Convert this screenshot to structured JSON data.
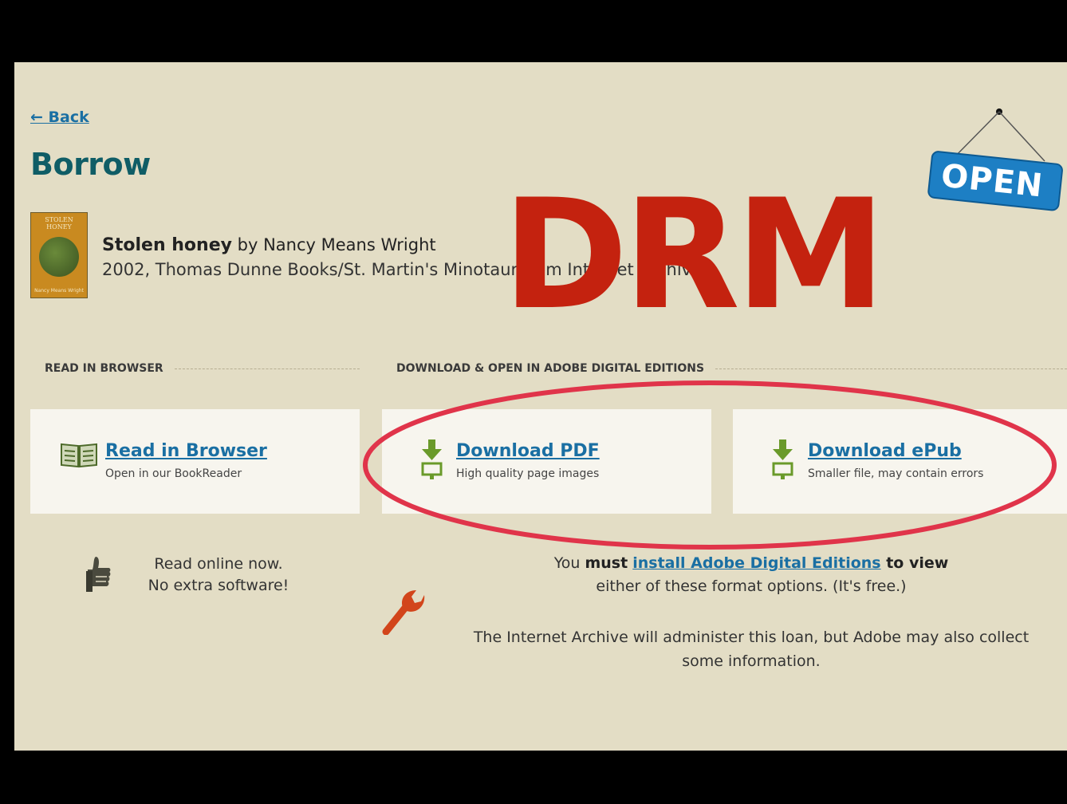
{
  "nav": {
    "back_label": "← Back"
  },
  "page": {
    "title": "Borrow"
  },
  "book": {
    "cover_title": "STOLEN HONEY",
    "cover_author": "Nancy Means Wright",
    "title": "Stolen honey",
    "by": " by Nancy Means Wright",
    "publication": "2002, Thomas Dunne Books/St. Martin's Minotaur from Internet Archive"
  },
  "sections": {
    "read_in_browser": "READ IN BROWSER",
    "download_open": "DOWNLOAD & OPEN IN ADOBE DIGITAL EDITIONS"
  },
  "cards": {
    "read": {
      "label": "Read in Browser",
      "sub": "Open in our BookReader"
    },
    "pdf": {
      "label": "Download PDF",
      "sub": "High quality page images"
    },
    "epub": {
      "label": "Download ePub",
      "sub": "Smaller file, may contain errors"
    }
  },
  "notes": {
    "read_line1": "Read online now.",
    "read_line2": "No extra software!",
    "adobe_pre": "You ",
    "adobe_must": "must",
    "adobe_space": " ",
    "adobe_link": "install Adobe Digital Editions",
    "adobe_post_bold": " to view",
    "adobe_line2": "either of these format options. (It's free.)",
    "loan": "The Internet Archive will administer this loan, but Adobe may also collect some information."
  },
  "overlay": {
    "open_sign": "OPEN",
    "drm": "DRM"
  },
  "colors": {
    "background": "#e3ddc5",
    "link": "#1a6fa3",
    "title": "#0f5d66",
    "drm_red": "#c4220f",
    "ellipse_red": "#e0344a",
    "open_blue": "#1d7fc4",
    "download_green": "#6a9a2a"
  },
  "icons": {
    "read": "open-book-icon",
    "download": "download-arrow-icon",
    "thumb": "thumbs-up-icon",
    "wrench": "wrench-icon"
  }
}
